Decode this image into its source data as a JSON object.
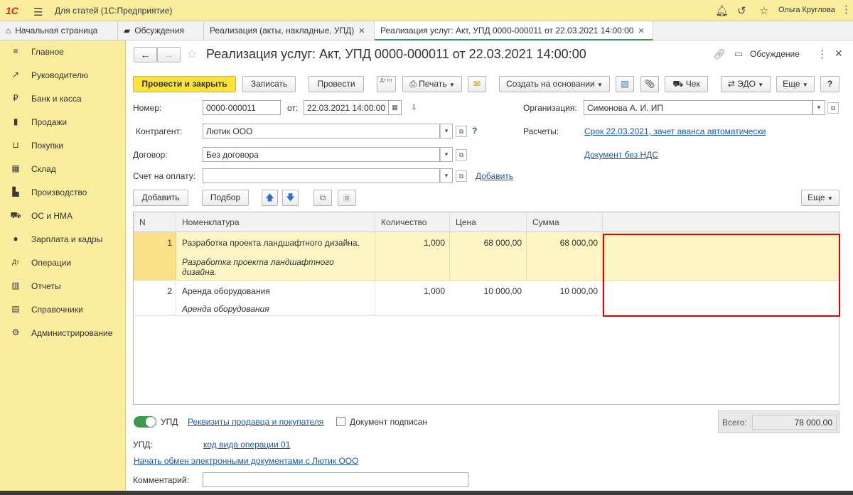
{
  "topbar": {
    "logo": "1С",
    "app_title": "Для статей  (1С:Предприятие)",
    "user": "Ольга Круглова"
  },
  "tabs": [
    {
      "label": "Начальная страница"
    },
    {
      "label": "Обсуждения"
    },
    {
      "label": "Реализация (акты, накладные, УПД)"
    },
    {
      "label": "Реализация услуг: Акт, УПД 0000-000011 от 22.03.2021 14:00:00"
    }
  ],
  "sidebar": {
    "items": [
      {
        "label": "Главное",
        "icon": "≡"
      },
      {
        "label": "Руководителю",
        "icon": "↗"
      },
      {
        "label": "Банк и касса",
        "icon": "₽"
      },
      {
        "label": "Продажи",
        "icon": "▮"
      },
      {
        "label": "Покупки",
        "icon": "⊔"
      },
      {
        "label": "Склад",
        "icon": "▦"
      },
      {
        "label": "Производство",
        "icon": "▙"
      },
      {
        "label": "ОС и НМА",
        "icon": "⛟"
      },
      {
        "label": "Зарплата и кадры",
        "icon": "●"
      },
      {
        "label": "Операции",
        "icon": "Дт"
      },
      {
        "label": "Отчеты",
        "icon": "▥"
      },
      {
        "label": "Справочники",
        "icon": "▤"
      },
      {
        "label": "Администрирование",
        "icon": "⚙"
      }
    ]
  },
  "doc": {
    "title": "Реализация услуг: Акт, УПД 0000-000011 от 22.03.2021 14:00:00",
    "discussion": "Обсуждение"
  },
  "toolbar": {
    "post_close": "Провести и закрыть",
    "save": "Записать",
    "post": "Провести",
    "dtkt": "Дт Кт",
    "print": "Печать",
    "create_based": "Создать на основании",
    "check": "Чек",
    "edo": "ЭДО",
    "more": "Еще",
    "help": "?"
  },
  "form": {
    "number_label": "Номер:",
    "number": "0000-000011",
    "from_label": "от:",
    "date": "22.03.2021 14:00:00",
    "org_label": "Организация:",
    "org": "Симонова А. И. ИП",
    "counterparty_label": "Контрагент:",
    "counterparty": "Лютик ООО",
    "question": "?",
    "settlements_label": "Расчеты:",
    "settlements_link": "Срок 22.03.2021, зачет аванса автоматически",
    "contract_label": "Договор:",
    "contract": "Без договора",
    "vat_link": "Документ без НДС",
    "invoice_label": "Счет на оплату:",
    "invoice": "",
    "invoice_add": "Добавить"
  },
  "table_toolbar": {
    "add": "Добавить",
    "pick": "Подбор",
    "more": "Еще"
  },
  "table": {
    "headers": [
      "N",
      "Номенклатура",
      "Количество",
      "Цена",
      "Сумма"
    ],
    "rows": [
      {
        "n": "1",
        "name": "Разработка проекта ландшафтного дизайна.",
        "desc1": "Разработка проекта ландшафтного",
        "desc2": "дизайна.",
        "qty": "1,000",
        "price": "68 000,00",
        "sum": "68 000,00"
      },
      {
        "n": "2",
        "name": "Аренда оборудования",
        "desc1": "Аренда оборудования",
        "desc2": "",
        "qty": "1,000",
        "price": "10 000,00",
        "sum": "10 000,00"
      }
    ]
  },
  "footer": {
    "upd_label": "УПД",
    "details_link": "Реквизиты продавца и покупателя",
    "signed": "Документ подписан",
    "total_label": "Всего:",
    "total": "78 000,00",
    "upd_field_label": "УПД:",
    "op_code_link": "код вида операции 01",
    "edo_link": "Начать обмен электронными документами с Лютик ООО",
    "comment_label": "Комментарий:",
    "comment": ""
  },
  "colors": {
    "accent": "#fbe33b",
    "sidebar": "#fbed9e",
    "link": "#1d56a8",
    "highlight": "#e00000",
    "selected_row": "#fdf5c4"
  }
}
